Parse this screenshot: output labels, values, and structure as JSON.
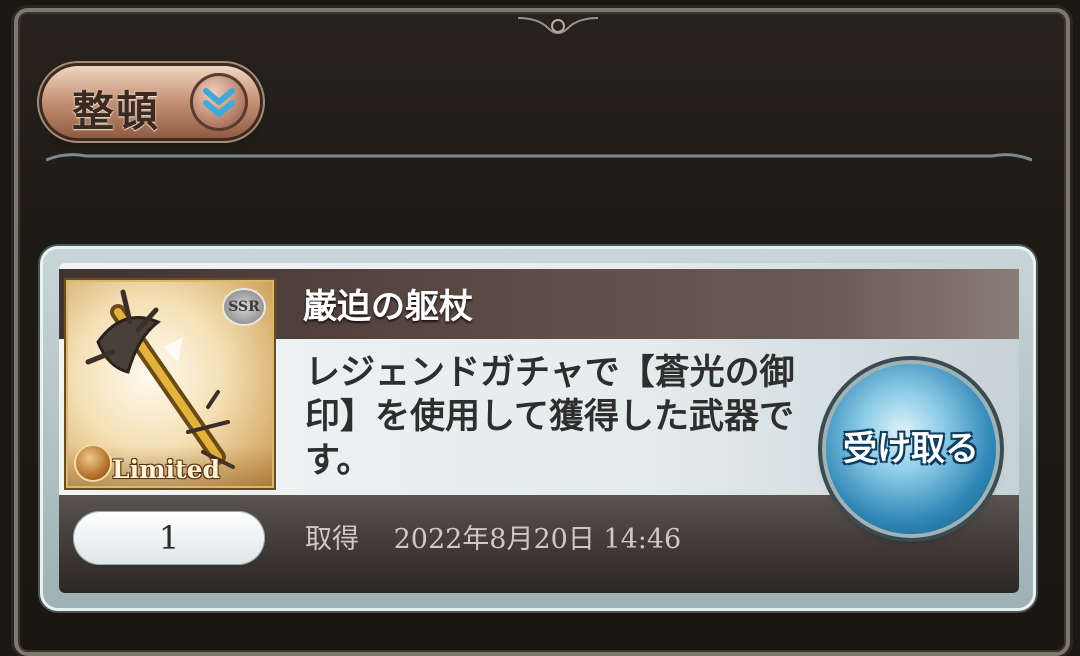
{
  "toolbar": {
    "sort_label": "整頓"
  },
  "item": {
    "name": "巌迫の躯杖",
    "description": "レジェンドガチャで【蒼光の御印】を使用して獲得した武器です。",
    "rarity_badge": "SSR",
    "limited_label": "Limited",
    "count": "1",
    "acquired_label": "取得",
    "acquired_datetime": "2022年8月20日 14:46",
    "receive_label": "受け取る"
  },
  "colors": {
    "background": "#1b1713",
    "receive_button": "#2f87b6",
    "sort_button": "#c9967a"
  },
  "icons": {
    "sort": "double-chevron-down-icon",
    "limited": "limited-emblem-icon"
  }
}
